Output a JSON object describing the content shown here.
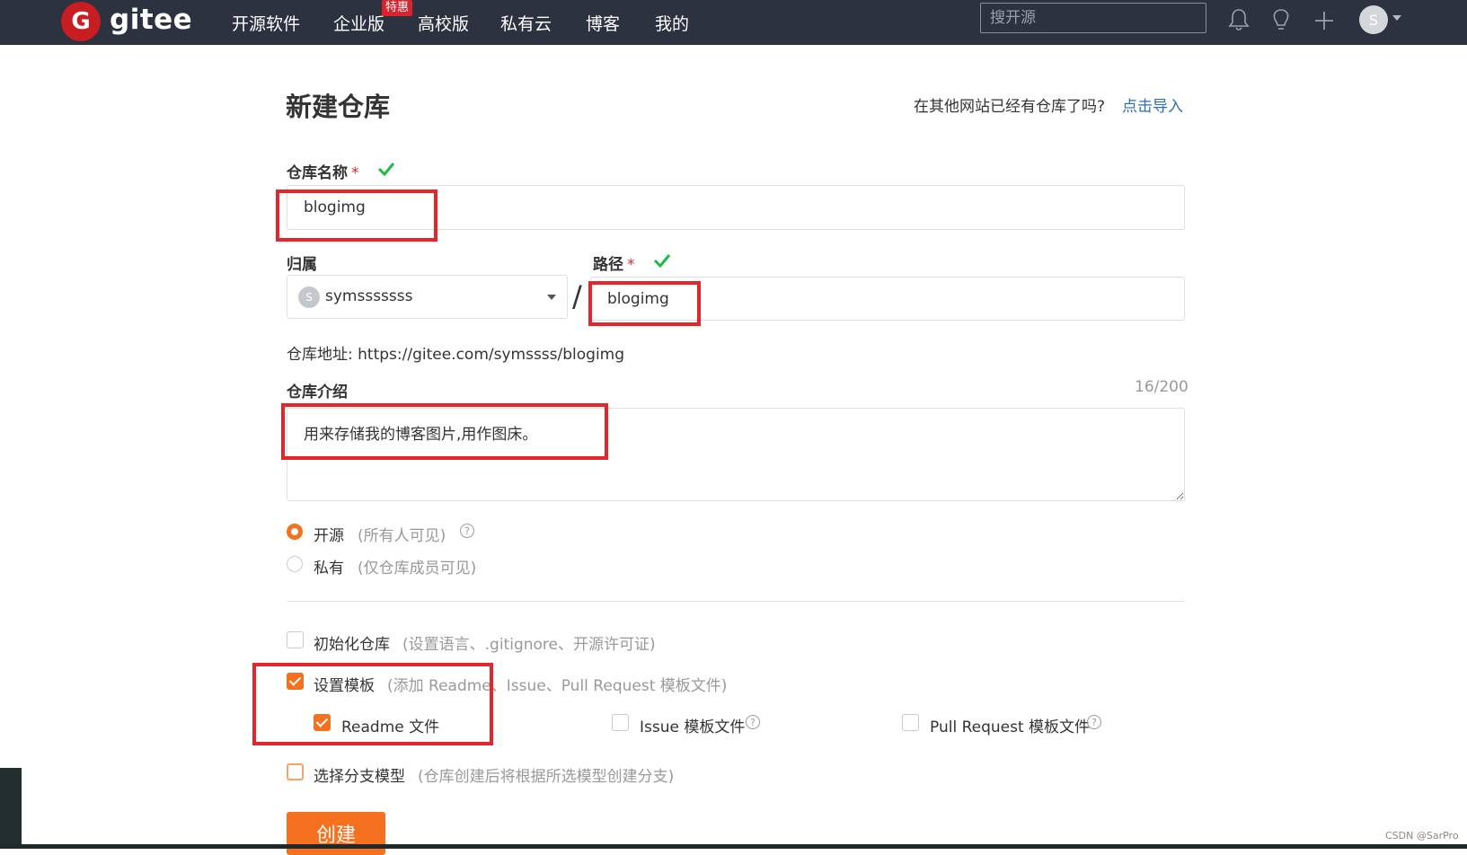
{
  "topbar": {
    "logo_letter": "G",
    "logo_text": "gitee",
    "nav": [
      {
        "label": "开源软件"
      },
      {
        "label": "企业版"
      },
      {
        "label": "高校版"
      },
      {
        "label": "私有云"
      },
      {
        "label": "博客"
      },
      {
        "label": "我的"
      }
    ],
    "nav_badge": "特惠",
    "search_placeholder": "搜开源",
    "avatar_letter": "S",
    "icons": [
      "bell-icon",
      "lightbulb-icon",
      "plus-icon"
    ]
  },
  "form": {
    "title": "新建仓库",
    "import_hint": "在其他网站已经有仓库了吗?",
    "import_link": "点击导入",
    "name_label": "仓库名称",
    "required_mark": "*",
    "name_value": "blogimg",
    "owner_label": "归属",
    "owner_avatar": "S",
    "owner_value": "symsssssss",
    "path_label": "路径",
    "path_value": "blogimg",
    "slash": "/",
    "repo_url": "仓库地址: https://gitee.com/symssss/blogimg",
    "desc_label": "仓库介绍",
    "desc_counter": "16/200",
    "desc_value": "用来存储我的博客图片,用作图床。",
    "visibility": [
      {
        "label": "开源",
        "hint": "(所有人可见)",
        "selected": true
      },
      {
        "label": "私有",
        "hint": "(仅仓库成员可见)",
        "selected": false
      }
    ],
    "init_repo": {
      "label": "初始化仓库",
      "hint": "(设置语言、.gitignore、开源许可证)",
      "checked": false
    },
    "set_template": {
      "label": "设置模板",
      "hint": "(添加 Readme、Issue、Pull Request 模板文件)",
      "checked": true
    },
    "templates": [
      {
        "label": "Readme 文件",
        "checked": true
      },
      {
        "label": "Issue 模板文件",
        "checked": false
      },
      {
        "label": "Pull Request 模板文件",
        "checked": false
      }
    ],
    "branch_model": {
      "label": "选择分支模型",
      "hint": "(仓库创建后将根据所选模型创建分支)",
      "checked": false
    },
    "create_button": "创建"
  },
  "watermark": "CSDN @SarPro",
  "colors": {
    "nav_bg": "#2d3240",
    "accent": "#f5701f",
    "highlight": "#e8242b",
    "link": "#2f6eb5",
    "ok": "#21ba45"
  }
}
